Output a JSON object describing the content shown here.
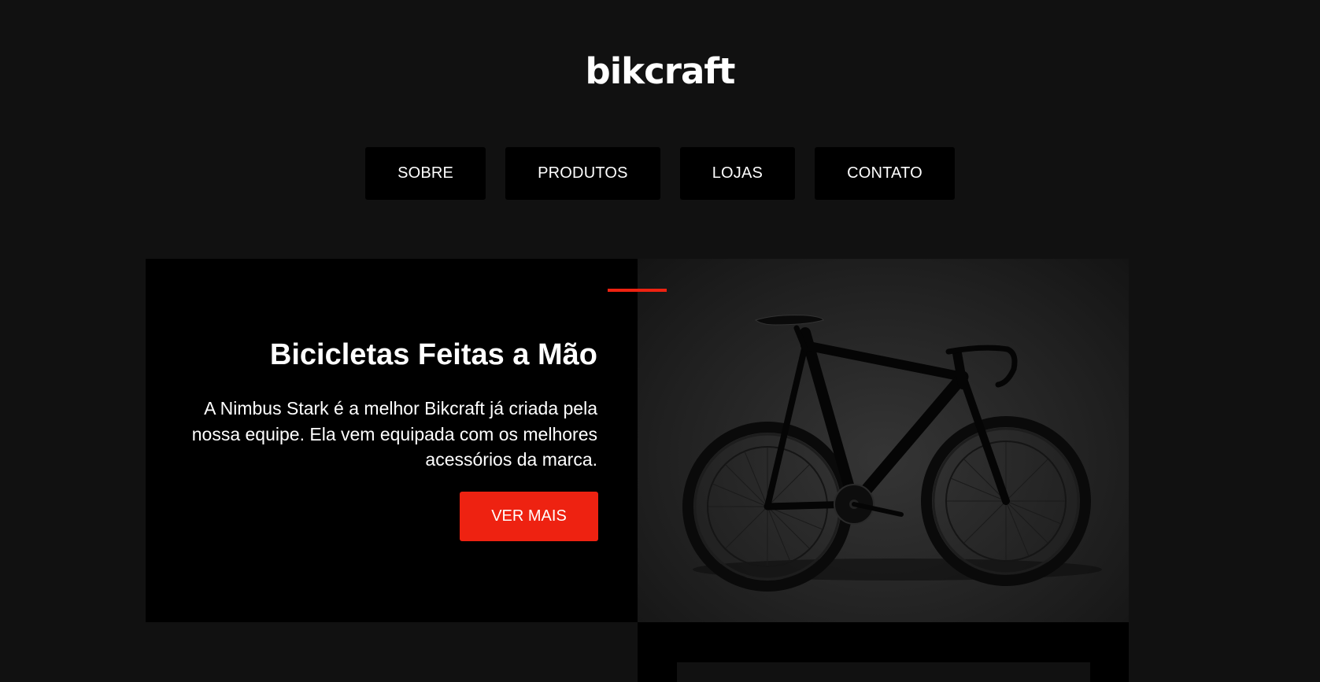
{
  "header": {
    "logo": "bikcraft"
  },
  "nav": {
    "items": [
      {
        "label": "SOBRE"
      },
      {
        "label": "PRODUTOS"
      },
      {
        "label": "LOJAS"
      },
      {
        "label": "CONTATO"
      }
    ]
  },
  "intro": {
    "title": "Bicicletas Feitas a Mão",
    "description": "A Nimbus Stark é a melhor Bikcraft já criada pela nossa equipe. Ela vem equipada com os melhores acessórios da marca.",
    "cta_label": "VER MAIS",
    "image_icon": "road-bicycle-photo"
  },
  "colors": {
    "background": "#111111",
    "panel": "#000000",
    "accent": "#EE2211",
    "text": "#FFFFFF"
  }
}
